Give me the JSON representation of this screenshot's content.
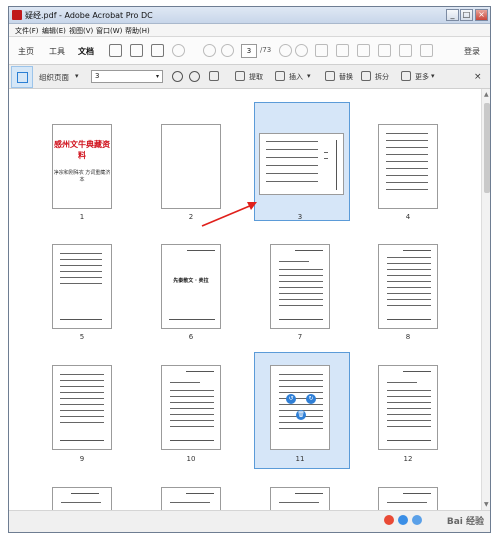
{
  "window": {
    "title": "疑经.pdf - Adobe Acrobat Pro DC",
    "min": "_",
    "max": "□",
    "close": "×"
  },
  "menu": [
    "文件(F)",
    "编辑(E)",
    "视图(V)",
    "窗口(W)",
    "帮助(H)"
  ],
  "main_toolbar": {
    "tabs": [
      "主页",
      "工具",
      "文档"
    ],
    "page_input": "3",
    "page_count": "/73",
    "login": "登录"
  },
  "organize_toolbar": {
    "label": "组织页面",
    "page_select": "3",
    "extract": "提取",
    "insert": "插入",
    "replace": "替换",
    "split": "拆分",
    "more": "更多"
  },
  "pages": [
    {
      "n": "1",
      "type": "cover",
      "title": "感州文牛典藏资料",
      "subtitle": "净宗和刚殊农\n方词重藏济本"
    },
    {
      "n": "2",
      "type": "blank"
    },
    {
      "n": "3",
      "type": "landscape",
      "selected": true
    },
    {
      "n": "4",
      "type": "list"
    },
    {
      "n": "5",
      "type": "list"
    },
    {
      "n": "6",
      "type": "chapter",
      "heading": "先秦散文 · 卖拉"
    },
    {
      "n": "7",
      "type": "text"
    },
    {
      "n": "8",
      "type": "text"
    },
    {
      "n": "9",
      "type": "text"
    },
    {
      "n": "10",
      "type": "text"
    },
    {
      "n": "11",
      "type": "text",
      "selected": true
    },
    {
      "n": "12",
      "type": "text"
    },
    {
      "n": "",
      "type": "partial"
    },
    {
      "n": "",
      "type": "partial"
    },
    {
      "n": "",
      "type": "partial"
    },
    {
      "n": "",
      "type": "partial"
    }
  ],
  "watermark": "Bai 经验",
  "colors": {
    "selection": "#d6e6f8",
    "selection_border": "#5b9bd8",
    "arrow": "#e0201b",
    "accent": "#2f7fd6"
  }
}
